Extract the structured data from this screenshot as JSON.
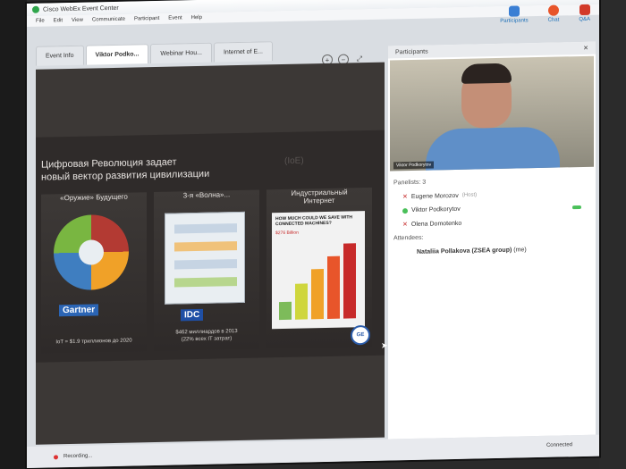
{
  "window": {
    "title": "Cisco WebEx Event Center",
    "menu": [
      "File",
      "Edit",
      "View",
      "Communicate",
      "Participant",
      "Event",
      "Help"
    ]
  },
  "toolbar": {
    "participants_label": "Participants",
    "chat_label": "Chat",
    "qa_label": "Q&A"
  },
  "tabs": [
    {
      "label": "Event Info"
    },
    {
      "label": "Viktor Podko..."
    },
    {
      "label": "Webinar Hou..."
    },
    {
      "label": "Internet of E..."
    }
  ],
  "slide": {
    "title_line1": "Цифровая Революция задает",
    "title_line2": "новый вектор развития цивилизации",
    "ghost_text": "(IoE)",
    "columns": [
      {
        "heading": "«Оружие» Будущего",
        "brand": "Gartner",
        "caption": "IoT = $1.9 триллионов до 2020"
      },
      {
        "heading": "3-я «Волна»...",
        "brand": "IDC",
        "caption_line1": "$462 миллиардов в 2013",
        "caption_line2": "(22% всех IT затрат)"
      },
      {
        "heading_line1": "Индустриальный",
        "heading_line2": "Интернет",
        "chart_question": "HOW MUCH COULD WE SAVE WITH CONNECTED MACHINES?",
        "chart_value": "$276 Billion",
        "logo": "GE"
      }
    ]
  },
  "panel": {
    "header": "Participants",
    "video_label": "Viktor Podkorytov",
    "panelists_label": "Panelists: 3",
    "panelists": [
      {
        "name": "Eugene Morozov",
        "role": "(Host)"
      },
      {
        "name": "Viktor Podkorytov",
        "role": ""
      },
      {
        "name": "Olena Domotenko",
        "role": ""
      }
    ],
    "attendees_label": "Attendees:",
    "attendees": [
      {
        "name": "Nataliia Pollakova (ZSEA group)",
        "role": "(me)"
      }
    ]
  },
  "status": {
    "recording": "Recording...",
    "connection": "Connected"
  }
}
